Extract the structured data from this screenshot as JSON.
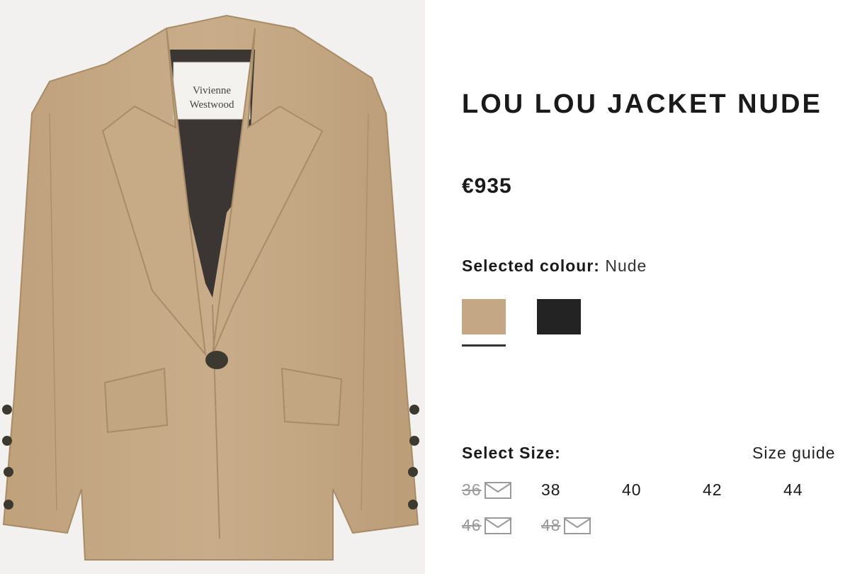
{
  "product": {
    "title": "LOU LOU JACKET NUDE",
    "price": "€935",
    "brand_label": [
      "Vivienne",
      "Westwood"
    ]
  },
  "colour": {
    "label": "Selected colour:",
    "value": "Nude",
    "swatches": [
      {
        "name": "Nude",
        "color": "#c4a784",
        "selected": true
      },
      {
        "name": "Black",
        "color": "#232323",
        "selected": false
      }
    ]
  },
  "size": {
    "heading": "Select Size:",
    "guide_label": "Size guide",
    "options": [
      {
        "label": "36",
        "available": false,
        "icon": "mail-icon"
      },
      {
        "label": "38",
        "available": true
      },
      {
        "label": "40",
        "available": true
      },
      {
        "label": "42",
        "available": true
      },
      {
        "label": "44",
        "available": true
      },
      {
        "label": "46",
        "available": false,
        "icon": "mail-icon"
      },
      {
        "label": "48",
        "available": false,
        "icon": "mail-icon"
      }
    ]
  },
  "colors": {
    "jacket": "#c4a784",
    "lining": "#3b3533",
    "text": "#1a1a1a",
    "unavailable": "#9a9a9a"
  }
}
